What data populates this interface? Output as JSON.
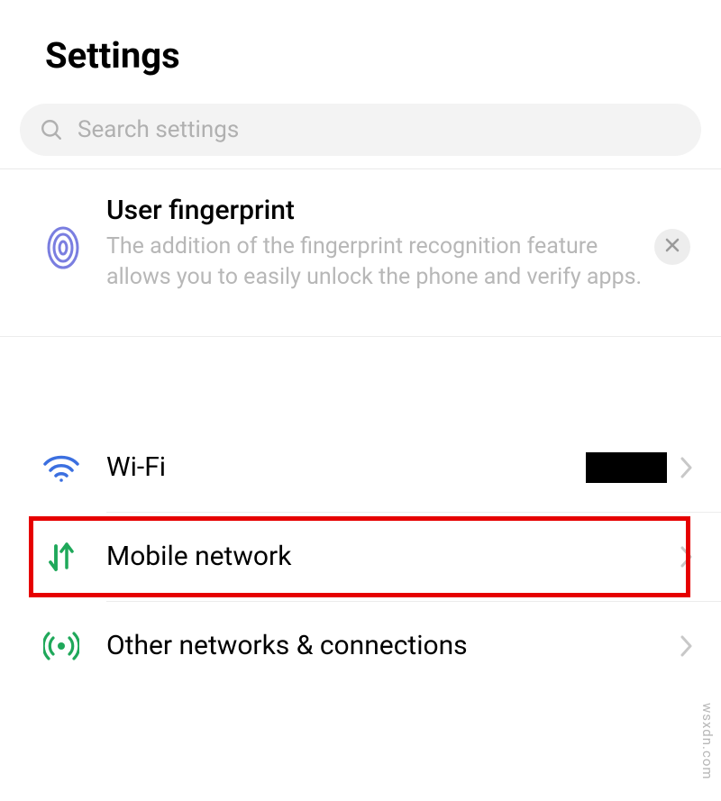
{
  "header": {
    "title": "Settings"
  },
  "search": {
    "placeholder": "Search settings"
  },
  "card": {
    "icon": "fingerprint-icon",
    "title": "User fingerprint",
    "description": "The addition of the fingerprint recognition feature allows you to easily unlock the phone and verify apps."
  },
  "rows": [
    {
      "icon": "wifi-icon",
      "label": "Wi-Fi",
      "value_redacted": true
    },
    {
      "icon": "mobile-data-icon",
      "label": "Mobile network",
      "highlighted": true
    },
    {
      "icon": "broadcast-icon",
      "label": "Other networks & connections"
    }
  ],
  "watermark": "wsxdn.com"
}
